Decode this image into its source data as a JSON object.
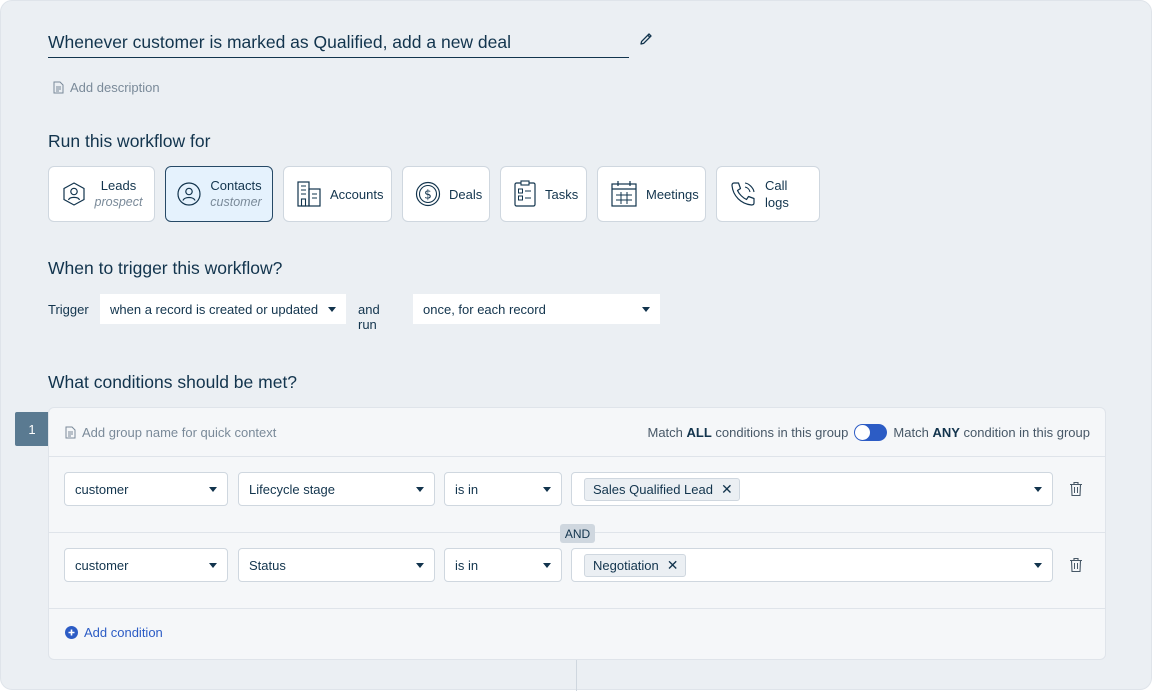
{
  "workflow": {
    "title": "Whenever customer is marked as Qualified, add a new deal",
    "add_description": "Add description"
  },
  "run_for": {
    "heading": "Run this workflow for",
    "entities": [
      {
        "label": "Leads",
        "sub": "prospect",
        "icon": "lead-user-icon"
      },
      {
        "label": "Contacts",
        "sub": "customer",
        "icon": "contact-user-icon",
        "selected": true
      },
      {
        "label": "Accounts",
        "icon": "building-icon"
      },
      {
        "label": "Deals",
        "icon": "dollar-coin-icon"
      },
      {
        "label": "Tasks",
        "icon": "clipboard-checklist-icon"
      },
      {
        "label": "Meetings",
        "icon": "calendar-icon"
      },
      {
        "label": "Call logs",
        "icon": "phone-icon"
      }
    ]
  },
  "trigger": {
    "heading": "When to trigger this workflow?",
    "trigger_label": "Trigger",
    "trigger_value": "when a record is created or updated",
    "run_label": "and run",
    "run_value": "once, for each record"
  },
  "conditions": {
    "heading": "What conditions should be met?",
    "group_number": "1",
    "group_name_placeholder": "Add group name for quick context",
    "match_all_pre": "Match",
    "match_all_bold": "ALL",
    "match_all_post": "conditions in this group",
    "match_any_pre": "Match",
    "match_any_bold": "ANY",
    "match_any_post": "condition in this group",
    "rows": [
      {
        "entity": "customer",
        "field": "Lifecycle stage",
        "operator": "is in",
        "value": "Sales Qualified Lead"
      },
      {
        "entity": "customer",
        "field": "Status",
        "operator": "is in",
        "value": "Negotiation"
      }
    ],
    "and_label": "AND",
    "add_condition": "Add condition"
  },
  "colors": {
    "background": "#ebeff3",
    "text": "#12344d",
    "accent": "#2c5cc5",
    "selected_bg": "#e5f2fd"
  }
}
